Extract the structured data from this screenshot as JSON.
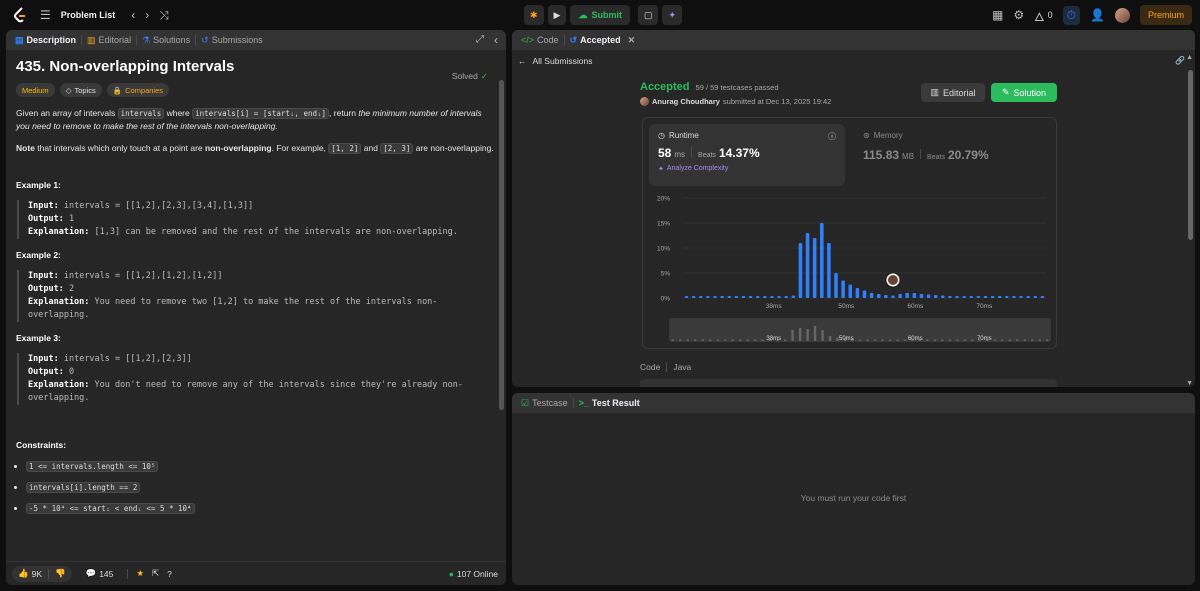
{
  "topbar": {
    "problem_list": "Problem List",
    "submit": "Submit",
    "streak": "0",
    "premium": "Premium"
  },
  "left_tabs": {
    "description": "Description",
    "editorial": "Editorial",
    "solutions": "Solutions",
    "submissions": "Submissions"
  },
  "problem": {
    "title": "435. Non-overlapping Intervals",
    "solved": "Solved",
    "tags": {
      "difficulty": "Medium",
      "topics": "Topics",
      "companies": "Companies"
    },
    "p1_a": "Given an array of intervals ",
    "p1_code1": "intervals",
    "p1_b": " where ",
    "p1_code2": "intervals[i] = [startᵢ, endᵢ]",
    "p1_c": ", return ",
    "p1_em": "the minimum number of intervals you need to remove to make the rest of the intervals non-overlapping.",
    "p2_note": "Note",
    "p2_a": " that intervals which only touch at a point are ",
    "p2_b": "non-overlapping",
    "p2_c": ". For example, ",
    "p2_code1": "[1, 2]",
    "p2_d": " and ",
    "p2_code2": "[2, 3]",
    "p2_e": " are non-overlapping.",
    "examples": [
      {
        "heading": "Example 1:",
        "input": "intervals = [[1,2],[2,3],[3,4],[1,3]]",
        "output": "1",
        "explanation": "[1,3] can be removed and the rest of the intervals are non-overlapping."
      },
      {
        "heading": "Example 2:",
        "input": "intervals = [[1,2],[1,2],[1,2]]",
        "output": "2",
        "explanation": "You need to remove two [1,2] to make the rest of the intervals non-overlapping."
      },
      {
        "heading": "Example 3:",
        "input": "intervals = [[1,2],[2,3]]",
        "output": "0",
        "explanation": "You don't need to remove any of the intervals since they're already non-overlapping."
      }
    ],
    "labels": {
      "input": "Input:",
      "output": "Output:",
      "explanation": "Explanation:"
    },
    "constraints_heading": "Constraints:",
    "constraints": [
      "1 <= intervals.length <= 10⁵",
      "intervals[i].length == 2",
      "-5 * 10⁴ <= startᵢ < endᵢ <= 5 * 10⁴"
    ]
  },
  "footer": {
    "likes": "9K",
    "comments": "145",
    "online": "107 Online"
  },
  "right_tabs": {
    "code": "Code",
    "accepted": "Accepted"
  },
  "submission": {
    "all_submissions": "All Submissions",
    "status": "Accepted",
    "testcases": "59 / 59 testcases passed",
    "user": "Anurag Choudhary",
    "submitted_at": "submitted at Dec 13, 2025 19:42",
    "editorial_btn": "Editorial",
    "solution_btn": "Solution",
    "runtime_label": "Runtime",
    "runtime_value": "58",
    "runtime_unit": "ms",
    "beats_label": "Beats",
    "runtime_beats": "14.37%",
    "analyze": "Analyze Complexity",
    "memory_label": "Memory",
    "memory_value": "115.83",
    "memory_unit": "MB",
    "memory_beats": "20.79%",
    "code_label": "Code",
    "lang": "Java"
  },
  "chart_data": {
    "type": "bar",
    "yticks": [
      "20%",
      "15%",
      "10%",
      "5%",
      "0%"
    ],
    "ylim": [
      0,
      20
    ],
    "xticks": [
      "38ms",
      "50ms",
      "60ms",
      "70ms"
    ],
    "values": [
      0.4,
      0.4,
      0.4,
      0.4,
      0.4,
      0.4,
      0.4,
      0.4,
      0.4,
      0.4,
      0.4,
      0.4,
      0.4,
      0.4,
      0.4,
      0.5,
      11,
      13,
      12,
      15,
      11,
      5,
      3.5,
      2.7,
      2,
      1.5,
      1,
      0.8,
      0.6,
      0.5,
      0.8,
      1,
      1,
      0.8,
      0.7,
      0.6,
      0.5,
      0.4,
      0.4,
      0.4,
      0.4,
      0.4,
      0.4,
      0.4,
      0.4,
      0.4,
      0.4,
      0.4,
      0.4,
      0.4,
      0.4
    ],
    "color": "#2f7fff"
  },
  "testpanel": {
    "testcase": "Testcase",
    "test_result": "Test Result",
    "empty": "You must run your code first"
  }
}
